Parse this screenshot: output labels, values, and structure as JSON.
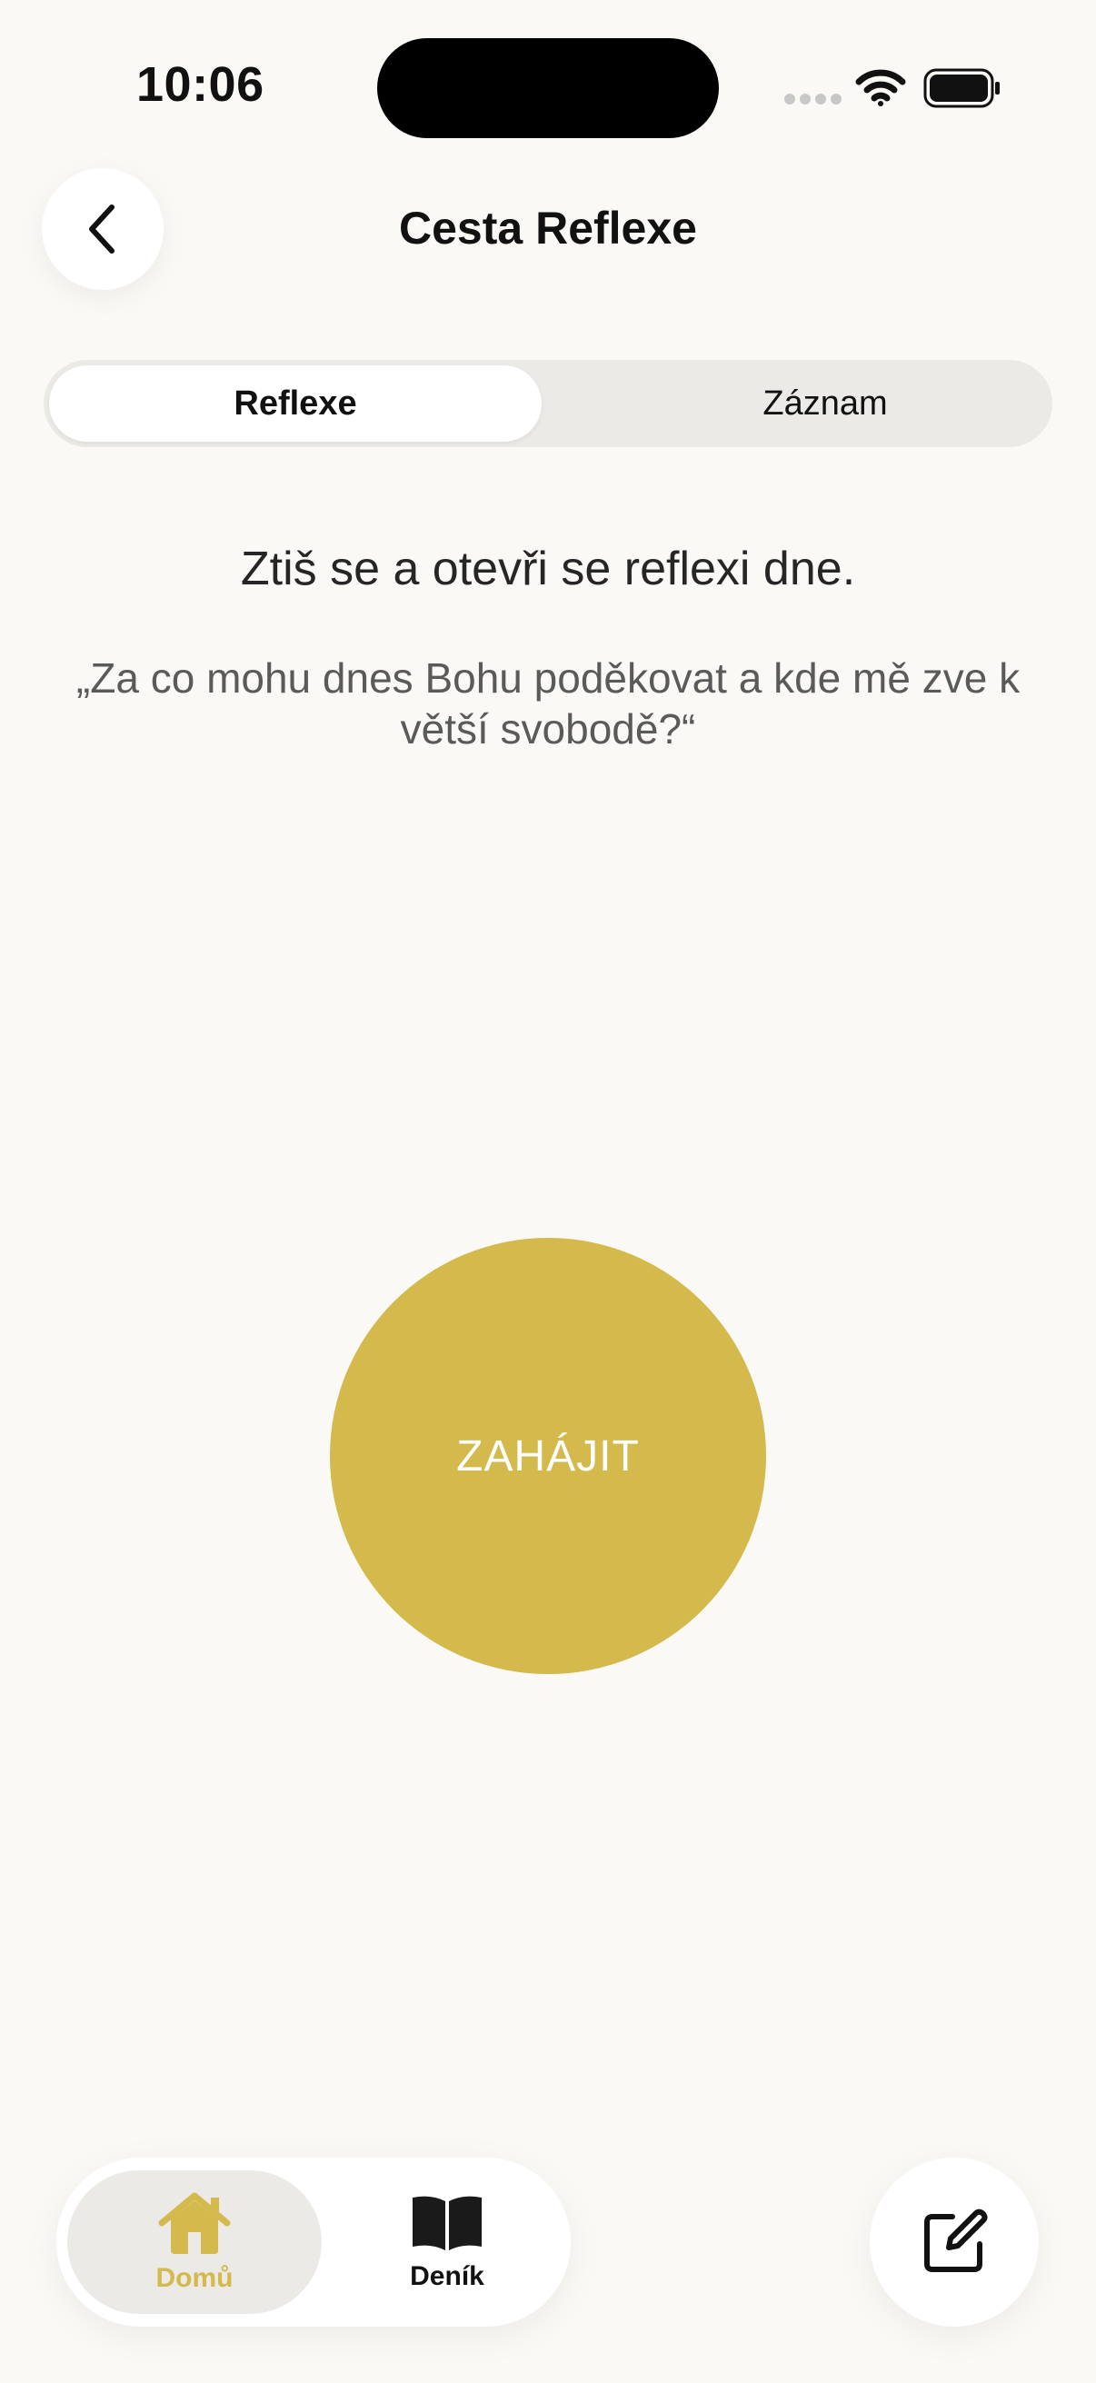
{
  "status_bar": {
    "time": "10:06"
  },
  "header": {
    "title": "Cesta Reflexe",
    "back_icon": "chevron-left-icon"
  },
  "segmented": {
    "tabs": [
      {
        "label": "Reflexe",
        "selected": true
      },
      {
        "label": "Záznam",
        "selected": false
      }
    ]
  },
  "content": {
    "heading": "Ztiš se a otevři se reflexi dne.",
    "quote": "„Za co mohu dnes Bohu poděkovat a kde mě zve k větší svobodě?“",
    "start_label": "ZAHÁJIT"
  },
  "tab_bar": {
    "items": [
      {
        "label": "Domů",
        "icon": "house-icon",
        "active": true
      },
      {
        "label": "Deník",
        "icon": "book-icon",
        "active": false
      }
    ],
    "compose_icon": "compose-icon"
  },
  "colors": {
    "accent": "#D4B94C",
    "background": "#FBF9F5",
    "segment_bg": "#ECEAE6"
  }
}
